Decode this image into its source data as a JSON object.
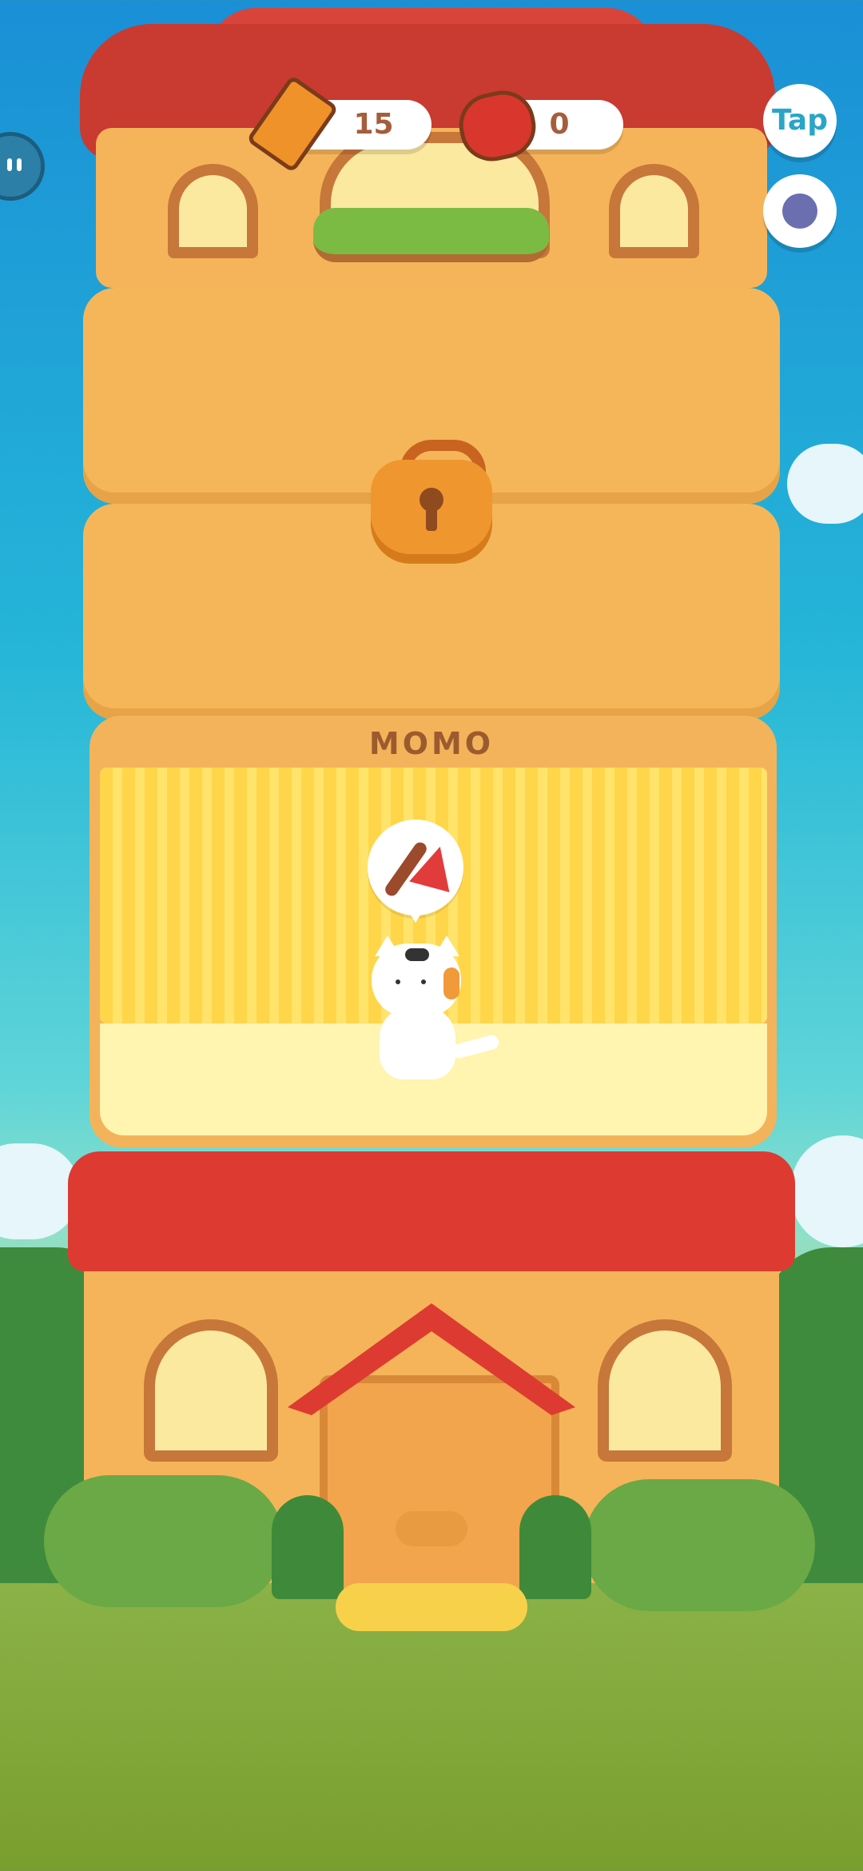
{
  "hud": {
    "pencils": {
      "icon": "pencil-icon",
      "count": "15"
    },
    "cans": {
      "icon": "fish-can-icon",
      "count": "0"
    },
    "tap_label": "Tap",
    "settings_icon": "gear-icon",
    "side_icon": "chat-bubble-icon"
  },
  "tower": {
    "locked_floor_icon": "padlock-icon",
    "room": {
      "nameplate": "MOMO",
      "speech_icon": "paintbrush-icon",
      "character": "calico-cat"
    },
    "ground_floor": {
      "door_icon": "fish-icon",
      "mat_icon": "paw-print-icon"
    }
  },
  "colors": {
    "roof_red": "#dd3b31",
    "wall_orange": "#f5b45a",
    "room_yellow": "#ffd64a",
    "accent_blue": "#2aa5c8",
    "counter_text": "#a55d3c"
  }
}
